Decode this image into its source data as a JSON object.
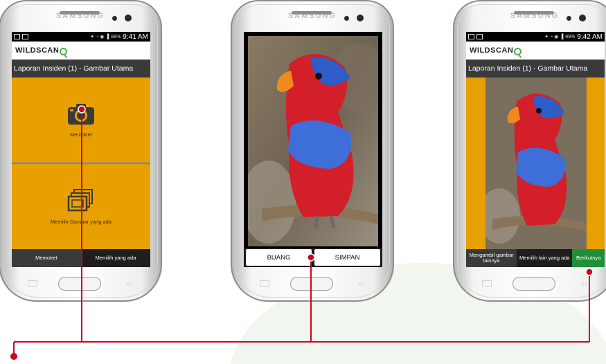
{
  "phone_brand": "SAMSUNG",
  "status_bar_1": {
    "time": "9:41 AM",
    "battery": "89%"
  },
  "status_bar_3": {
    "time": "9:42 AM",
    "battery": "89%"
  },
  "app": {
    "logo": "WILDSCAN",
    "title": "Laporan Insiden (1) - Gambar Utama"
  },
  "screen1": {
    "camera_label": "Memotret",
    "gallery_label": "Memilih Gambar yang ada",
    "tab_left": "Memotret",
    "tab_right": "Memilih yang ada"
  },
  "screen2": {
    "discard_button": "BUANG",
    "save_button": "SIMPAN"
  },
  "screen3": {
    "tab_retake": "Mengambil gambar lainnya",
    "tab_choose_other": "Memilih lain yang ada",
    "tab_next": "Berikutnya"
  },
  "colors": {
    "accent_orange": "#e8a000",
    "title_bar": "#3a3a3a",
    "next_green": "#1f8f3a",
    "pointer_red": "#d0021b"
  },
  "icons": [
    "camera-icon",
    "gallery-icon",
    "wildscan-logo-icon"
  ]
}
